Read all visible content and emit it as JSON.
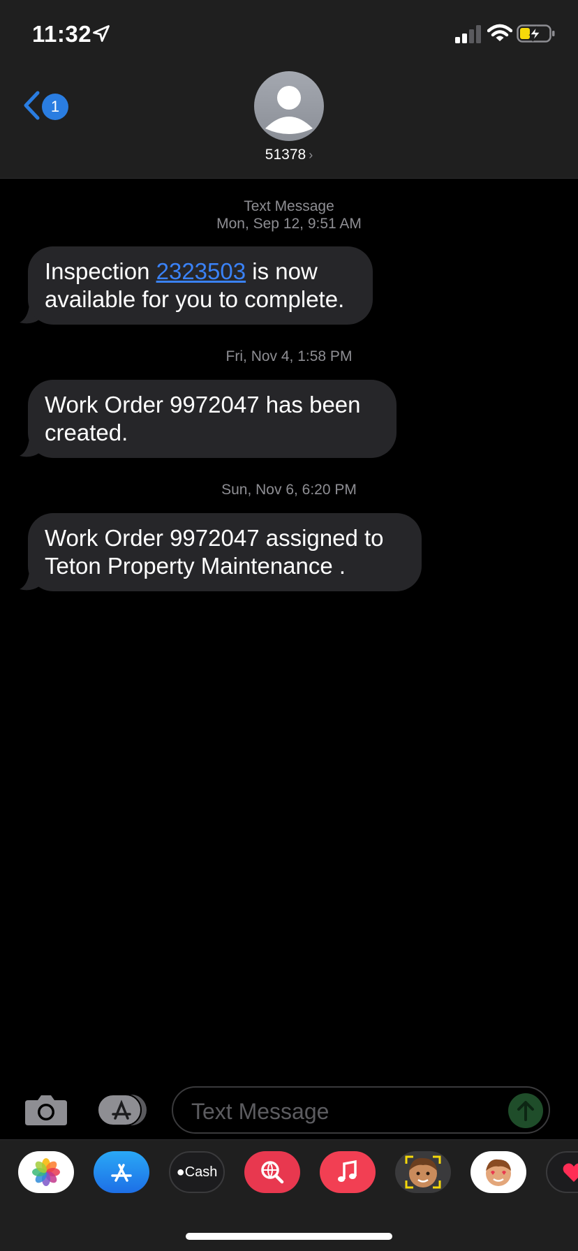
{
  "status_bar": {
    "time": "11:32",
    "battery_level": 0.35,
    "battery_color": "#f5d90a",
    "signal_bars": 2
  },
  "nav": {
    "back_badge": "1",
    "contact_name": "51378",
    "accent": "#2a7de1"
  },
  "conversation": [
    {
      "timestamp_label": "Text Message",
      "timestamp": "Mon, Sep 12, 9:51 AM",
      "text_before": "Inspection ",
      "link": "2323503",
      "text_after": " is now available for you to complete."
    },
    {
      "timestamp": "Fri, Nov 4, 1:58 PM",
      "text": "Work Order 9972047 has been created."
    },
    {
      "timestamp": "Sun, Nov 6, 6:20 PM",
      "text": "Work Order 9972047 assigned to Teton Property Maintenance ."
    }
  ],
  "composer": {
    "placeholder": "Text Message"
  },
  "app_drawer": {
    "apps": [
      {
        "name": "photos-icon"
      },
      {
        "name": "app-store-icon"
      },
      {
        "name": "apple-cash-icon",
        "label": "Cash"
      },
      {
        "name": "web-search-icon"
      },
      {
        "name": "music-icon"
      },
      {
        "name": "memoji-icon"
      },
      {
        "name": "animoji-stickers-icon"
      },
      {
        "name": "digital-touch-icon"
      }
    ]
  }
}
